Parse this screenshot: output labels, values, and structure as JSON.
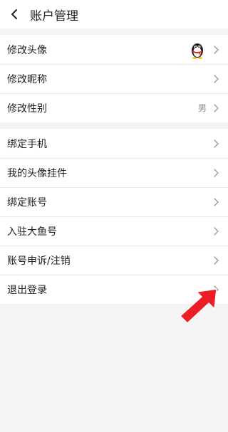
{
  "header": {
    "title": "账户管理",
    "back_icon": "chevron-left-icon"
  },
  "group1": {
    "items": [
      {
        "label": "修改头像",
        "value": "",
        "icon": "qq-penguin-avatar"
      },
      {
        "label": "修改昵称",
        "value": ""
      },
      {
        "label": "修改性别",
        "value": "男"
      }
    ]
  },
  "group2": {
    "items": [
      {
        "label": "绑定手机"
      },
      {
        "label": "我的头像挂件"
      },
      {
        "label": "绑定账号"
      },
      {
        "label": "入驻大鱼号"
      },
      {
        "label": "账号申诉/注销"
      },
      {
        "label": "退出登录"
      }
    ]
  },
  "annotation": {
    "color": "#ee1c24",
    "icon": "red-arrow-pointer"
  },
  "colors": {
    "background": "#f4f4f4",
    "surface": "#ffffff",
    "divider": "#ececec",
    "chevron": "#999999"
  }
}
